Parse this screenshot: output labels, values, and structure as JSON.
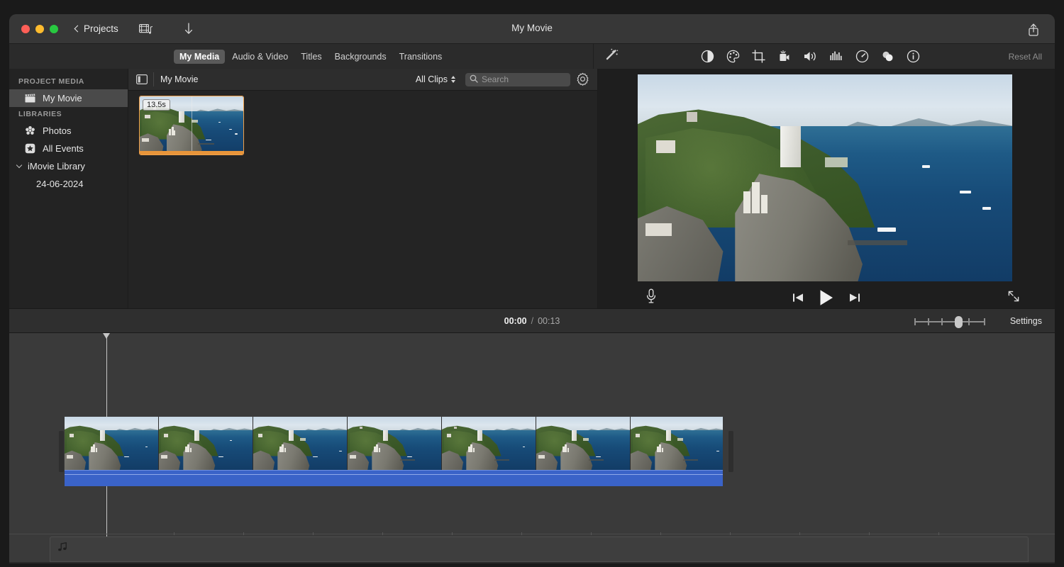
{
  "window": {
    "title": "My Movie",
    "back_label": "Projects",
    "traffic_lights": [
      "close",
      "minimize",
      "zoom"
    ],
    "toolbar_icons": [
      "media-import-icon",
      "download-icon",
      "share-icon"
    ]
  },
  "tabs": [
    {
      "label": "My Media",
      "active": true
    },
    {
      "label": "Audio & Video",
      "active": false
    },
    {
      "label": "Titles",
      "active": false
    },
    {
      "label": "Backgrounds",
      "active": false
    },
    {
      "label": "Transitions",
      "active": false
    }
  ],
  "adjustments": {
    "reset_label": "Reset All",
    "wand_icon": "magic-wand-icon",
    "tools": [
      "color-balance-icon",
      "color-correction-icon",
      "crop-icon",
      "stabilization-icon",
      "volume-icon",
      "equalizer-icon",
      "speed-icon",
      "filters-icon",
      "info-icon"
    ]
  },
  "sidebar": {
    "sections": [
      {
        "header": "PROJECT MEDIA",
        "items": [
          {
            "label": "My Movie",
            "icon": "clapperboard-icon",
            "selected": true
          }
        ]
      },
      {
        "header": "LIBRARIES",
        "items": [
          {
            "label": "Photos",
            "icon": "photos-icon",
            "selected": false
          },
          {
            "label": "All Events",
            "icon": "star-box-icon",
            "selected": false
          }
        ],
        "disclosure": {
          "label": "iMovie Library",
          "expanded": true
        },
        "children": [
          {
            "label": "24-06-2024"
          }
        ]
      }
    ]
  },
  "browser": {
    "panel_toggle_icon": "sidebar-toggle-icon",
    "title": "My Movie",
    "filter_label": "All Clips",
    "search": {
      "placeholder": "Search",
      "value": "",
      "icon": "search-icon"
    },
    "settings_icon": "gear-icon",
    "clips": [
      {
        "duration": "13.5s",
        "selected": true
      }
    ]
  },
  "viewer": {
    "controls": {
      "voiceover_icon": "microphone-icon",
      "previous_icon": "skip-to-start-icon",
      "play_icon": "play-icon",
      "next_icon": "skip-to-end-icon",
      "fullscreen_icon": "fullscreen-icon"
    }
  },
  "timeline": {
    "current_time": "00:00",
    "separator": "/",
    "total_time": "00:13",
    "zoom_value": 57,
    "settings_label": "Settings",
    "clip": {
      "selected": true,
      "has_audio_band": true,
      "frame_count": 7
    }
  }
}
